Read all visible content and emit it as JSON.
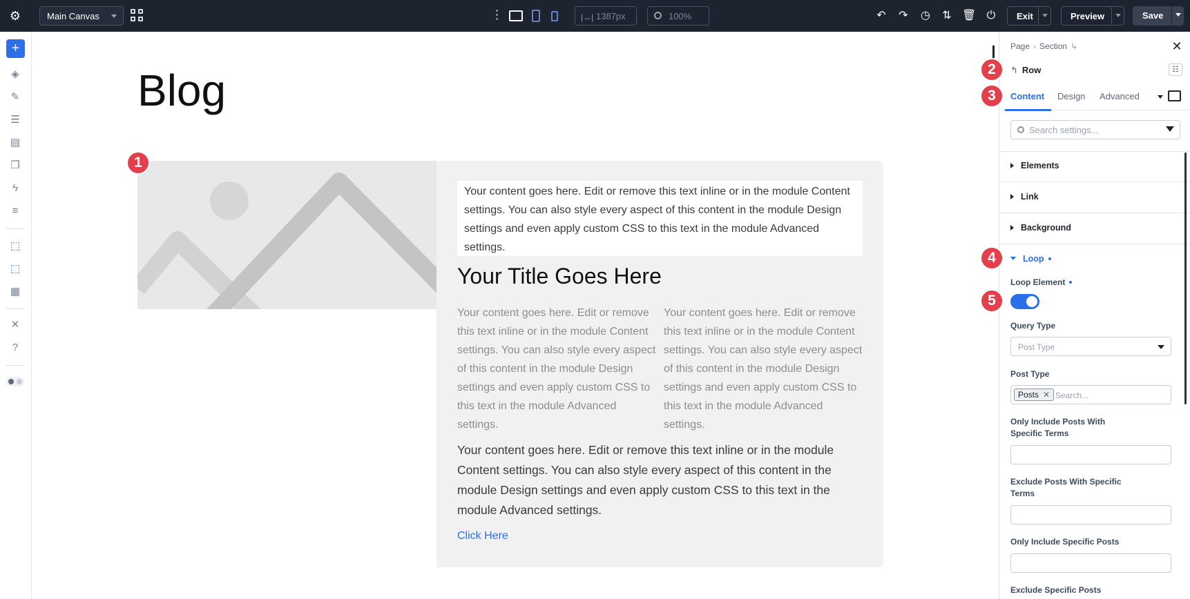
{
  "topbar": {
    "canvas_select": "Main Canvas",
    "width_value": "1387px",
    "zoom_value": "100%",
    "exit_label": "Exit",
    "preview_label": "Preview",
    "save_label": "Save",
    "icons": [
      "gear-icon",
      "grid-icon",
      "more-icon",
      "desktop-icon",
      "tablet-icon",
      "phone-icon",
      "undo-icon",
      "redo-icon",
      "history-icon",
      "sort-icon",
      "trash-icon",
      "power-icon"
    ]
  },
  "sidebar": {
    "icons": [
      "add-icon",
      "layers-icon",
      "paint-icon",
      "database-icon",
      "form-icon",
      "pages-icon",
      "lightning-icon",
      "layout-icon",
      "cursor-grid-icon",
      "cursor-grid-icon-2",
      "template-icon",
      "tools-icon",
      "help-icon",
      "theme-toggle-icon"
    ]
  },
  "canvas": {
    "page_title": "Blog",
    "intro_text": "Your content goes here. Edit or remove this text inline or in the module Content settings. You can also style every aspect of this content in the module Design settings and even apply custom CSS to this text in the module Advanced settings.",
    "card_title": "Your Title Goes Here",
    "col_text_left": "Your content goes here. Edit or remove this text inline or in the module Content settings. You can also style every aspect of this content in the module Design settings and even apply custom CSS to this text in the module Advanced settings.",
    "col_text_right": "Your content goes here. Edit or remove this text inline or in the module Content settings. You can also style every aspect of this content in the module Design settings and even apply custom CSS to this text in the module Advanced settings.",
    "wide_text": "Your content goes here. Edit or remove this text inline or in the module Content settings. You can also style every aspect of this content in the module Design settings and even apply custom CSS to this text in the module Advanced settings.",
    "link_text": "Click Here"
  },
  "badges": [
    "1",
    "2",
    "3",
    "4",
    "5"
  ],
  "panel": {
    "breadcrumb": [
      "Page",
      "Section"
    ],
    "row_title": "Row",
    "tabs": [
      "Content",
      "Design",
      "Advanced"
    ],
    "search_placeholder": "Search settings...",
    "groups": [
      "Elements",
      "Link",
      "Background",
      "Loop"
    ],
    "loop_element_label": "Loop Element",
    "loop_element_enabled": true,
    "query_type_label": "Query Type",
    "query_type_placeholder": "Post Type",
    "post_type_label": "Post Type",
    "post_type_tag": "Posts",
    "post_type_search": "Search...",
    "include_terms_label": "Only Include Posts With Specific Terms",
    "exclude_terms_label": "Exclude Posts With Specific Terms",
    "include_posts_label": "Only Include Specific Posts",
    "exclude_posts_label": "Exclude Specific Posts"
  },
  "colors": {
    "accent": "#2b6fea",
    "badge": "#e2404c",
    "topbar": "#1e2330"
  }
}
